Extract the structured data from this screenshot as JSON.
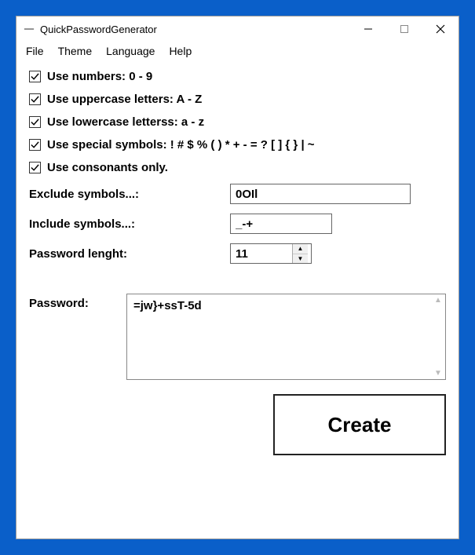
{
  "window": {
    "title": "QuickPasswordGenerator"
  },
  "menu": {
    "file": "File",
    "theme": "Theme",
    "language": "Language",
    "help": "Help"
  },
  "options": {
    "numbers_label": "Use numbers: 0 - 9",
    "numbers_checked": true,
    "uppercase_label": "Use uppercase letters: A - Z",
    "uppercase_checked": true,
    "lowercase_label": "Use lowercase letterss: a - z",
    "lowercase_checked": true,
    "special_label": "Use special symbols: ! # $ % ( ) * + - = ? [ ] { } | ~",
    "special_checked": true,
    "consonants_label": "Use consonants only.",
    "consonants_checked": true
  },
  "fields": {
    "exclude_label": "Exclude symbols...:",
    "exclude_value": "0OIl",
    "include_label": "Include symbols...:",
    "include_value": "_-+",
    "length_label": "Password lenght:",
    "length_value": "11"
  },
  "password": {
    "label": "Password:",
    "value": "=jw}+ssT-5d"
  },
  "buttons": {
    "create_label": "Create"
  }
}
